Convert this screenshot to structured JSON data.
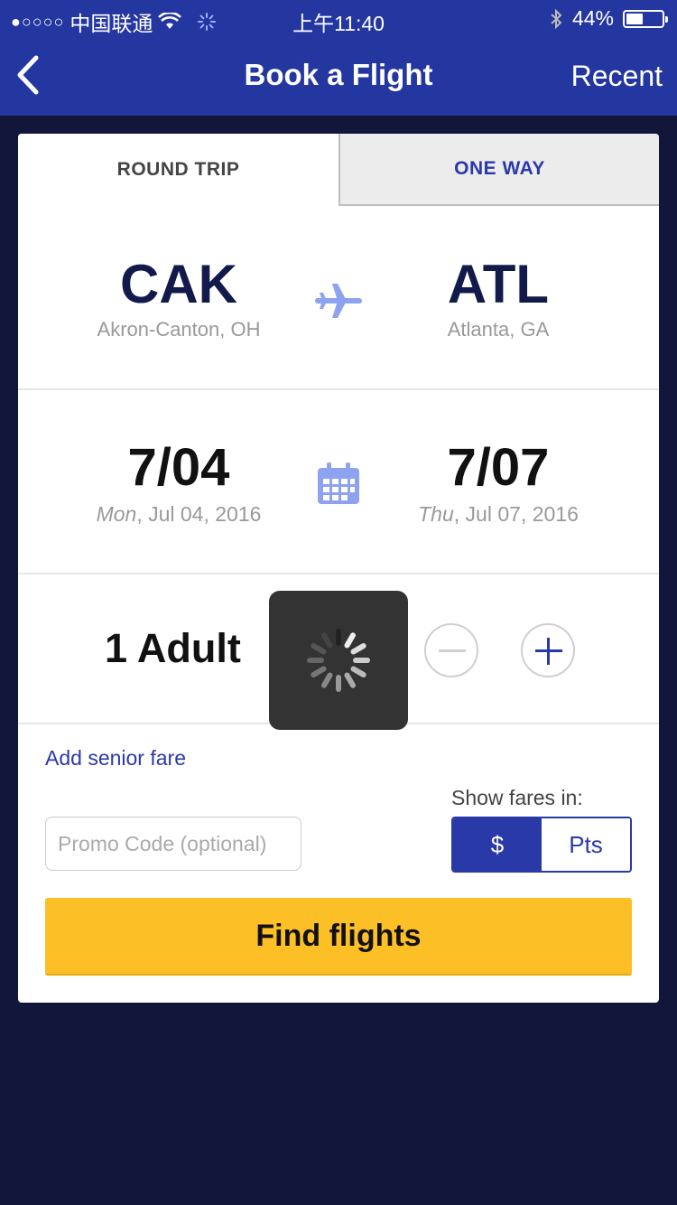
{
  "status_bar": {
    "carrier_dots": "●○○○○",
    "carrier": "中国联通",
    "time": "上午11:40",
    "battery_percent": "44%",
    "battery_level": 0.44
  },
  "nav": {
    "title": "Book a Flight",
    "recent_label": "Recent",
    "back_icon": "chevron-left-icon"
  },
  "tabs": {
    "round_trip": "ROUND TRIP",
    "one_way": "ONE WAY",
    "selected": "round_trip"
  },
  "route": {
    "origin_code": "CAK",
    "origin_city": "Akron-Canton, OH",
    "destination_code": "ATL",
    "destination_city": "Atlanta, GA",
    "icon": "airplane-icon"
  },
  "dates": {
    "depart_short": "7/04",
    "depart_day": "Mon",
    "depart_rest": ", Jul 04, 2016",
    "return_short": "7/07",
    "return_day": "Thu",
    "return_rest": ", Jul 07, 2016",
    "icon": "calendar-icon"
  },
  "passengers": {
    "label": "1 Adult"
  },
  "senior_link": "Add senior fare",
  "fares": {
    "label": "Show fares in:",
    "dollar": "$",
    "points": "Pts",
    "selected": "dollar"
  },
  "promo": {
    "placeholder": "Promo Code (optional)",
    "value": ""
  },
  "find_button": "Find flights",
  "colors": {
    "nav_blue": "#2436a0",
    "accent_blue": "#2a39a8",
    "background": "#11163a",
    "find_yellow": "#fdbf26",
    "icon_light_blue": "#8ea3f0"
  }
}
